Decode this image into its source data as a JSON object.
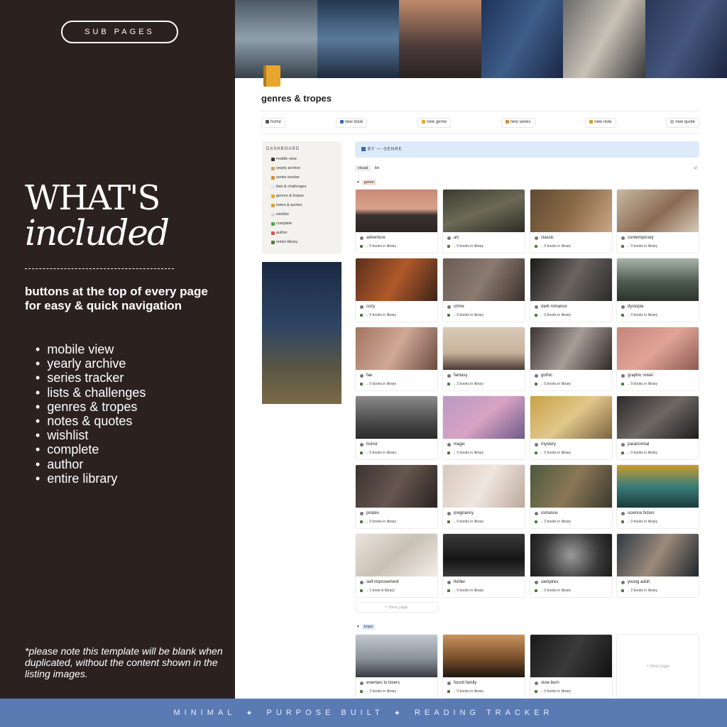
{
  "left": {
    "pill": "SUB PAGES",
    "heading_line1": "WHAT'S",
    "heading_line2": "included",
    "lead": "buttons at the top of every page for easy & quick navigation",
    "bullets": [
      "mobile view",
      "yearly archive",
      "series tracker",
      "lists & challenges",
      "genres & tropes",
      "notes & quotes",
      "wishlist",
      "complete",
      "author",
      "entire library"
    ],
    "note": "*please note this template will be blank when duplicated, without the content shown in the listing images."
  },
  "bottom_bar": {
    "part1": "MINIMAL",
    "sep": "✦",
    "part2": "PURPOSE BUILT",
    "part3": "READING TRACKER"
  },
  "page": {
    "title": "genres & tropes",
    "nav": [
      {
        "label": "home",
        "icon": "arrow-left-icon",
        "color": "#555555"
      },
      {
        "label": "new book",
        "icon": "book-icon",
        "color": "#3c68b0"
      },
      {
        "label": "new genre",
        "icon": "book-icon",
        "color": "#e7a72f"
      },
      {
        "label": "new series",
        "icon": "books-icon",
        "color": "#d98a2a"
      },
      {
        "label": "new note",
        "icon": "pencil-icon",
        "color": "#e0a020"
      },
      {
        "label": "new quote",
        "icon": "speech-bubble-icon",
        "color": "#bbbbbb"
      }
    ],
    "sidebar": {
      "title": "DASHBOARD",
      "items": [
        {
          "label": "mobile view",
          "color": "#333333"
        },
        {
          "label": "yearly archive",
          "color": "#c8a46a"
        },
        {
          "label": "series tracker",
          "color": "#d98a2a"
        },
        {
          "label": "lists & challenges",
          "color": "#e6e6e6"
        },
        {
          "label": "genres & tropes",
          "color": "#e7a72f"
        },
        {
          "label": "notes & quotes",
          "color": "#e0a020"
        },
        {
          "label": "wishlist",
          "color": "#d8d8d8"
        },
        {
          "label": "complete",
          "color": "#3fae3f"
        },
        {
          "label": "author",
          "color": "#d9534f"
        },
        {
          "label": "entire library",
          "color": "#4b7c3a"
        }
      ]
    },
    "callout": "BY — GENRE",
    "views": {
      "visual": "visual",
      "list": "list"
    },
    "group_genre": "genre",
    "group_trope": "trope",
    "new_page": "+ New page",
    "genres": [
      {
        "name": "adventure",
        "count": "→ 0 books in library",
        "bg": "linear-gradient(180deg,#c98a74,#d9a28c 45%,#3b3230 60%,#2b2523)"
      },
      {
        "name": "art",
        "count": "→ 0 books in library",
        "bg": "linear-gradient(160deg,#3b3b32,#6c6a55 50%,#2d2a24)"
      },
      {
        "name": "classic",
        "count": "→ 0 books in library",
        "bg": "linear-gradient(120deg,#5f4a32,#8a6a47 50%,#c9a688)"
      },
      {
        "name": "contemporary",
        "count": "→ 0 books in library",
        "bg": "linear-gradient(140deg,#c7b9a3,#8b6a52 55%,#d6cbbb)"
      },
      {
        "name": "cozy",
        "count": "→ 0 books in library",
        "bg": "linear-gradient(120deg,#5a2f1c,#b0592a 50%,#3d2419)"
      },
      {
        "name": "crime",
        "count": "→ 0 books in library",
        "bg": "linear-gradient(120deg,#6b5d55,#8a7a70 50%,#3b312c)"
      },
      {
        "name": "dark romance",
        "count": "→ 0 books in library",
        "bg": "linear-gradient(120deg,#1c1a1a,#6a6460 50%,#2c2a29)"
      },
      {
        "name": "dystopia",
        "count": "→ 0 books in library",
        "bg": "linear-gradient(180deg,#a7b3a9,#4e5b4f 55%,#2b332c)"
      },
      {
        "name": "fae",
        "count": "→ 0 books in library",
        "bg": "linear-gradient(120deg,#a27560,#d0a896 50%,#6a4c40)"
      },
      {
        "name": "fantasy",
        "count": "→ 2 books in library",
        "bg": "linear-gradient(180deg,#d8cbb7,#c8b29a 60%,#4a3a33)"
      },
      {
        "name": "gothic",
        "count": "→ 0 books in library",
        "bg": "linear-gradient(120deg,#3c3432,#a89d96 50%,#2e2826)"
      },
      {
        "name": "graphic novel",
        "count": "→ 0 books in library",
        "bg": "linear-gradient(140deg,#c5857a,#e0a496 50%,#8d5a52)"
      },
      {
        "name": "horror",
        "count": "→ 0 books in library",
        "bg": "linear-gradient(180deg,#8a8a8a,#4a4a4a 60%,#2a2a2a)"
      },
      {
        "name": "magic",
        "count": "→ 0 books in library",
        "bg": "linear-gradient(140deg,#b79ac6,#d9a3c3 50%,#6d5a8a)"
      },
      {
        "name": "mystery",
        "count": "→ 0 books in library",
        "bg": "linear-gradient(140deg,#c9a24a,#e1c78a 50%,#7a6340)"
      },
      {
        "name": "paranormal",
        "count": "→ 0 books in library",
        "bg": "linear-gradient(140deg,#2d2a2a,#6e6864 50%,#1f1d1d)"
      },
      {
        "name": "pirates",
        "count": "→ 0 books in library",
        "bg": "linear-gradient(120deg,#3b3331,#66564f 50%,#2a2322)"
      },
      {
        "name": "pregnancy",
        "count": "→ 0 books in library",
        "bg": "linear-gradient(120deg,#d8c8bc,#efe6df 50%,#bba99c)"
      },
      {
        "name": "romance",
        "count": "→ 2 books in library",
        "bg": "linear-gradient(120deg,#4b5a3e,#8b7756 50%,#3a3a2c)"
      },
      {
        "name": "science fiction",
        "count": "→ 0 books in library",
        "bg": "linear-gradient(180deg,#c99a30,#3a7d78 50%,#1a3a3c)"
      },
      {
        "name": "self improvement",
        "count": "→ 1 book in library",
        "bg": "linear-gradient(140deg,#e9e4dc,#c9c0b4 50%,#f2eee8)"
      },
      {
        "name": "thriller",
        "count": "→ 0 books in library",
        "bg": "linear-gradient(180deg,#3a3a3a,#151515 60%,#3c3c3c)"
      },
      {
        "name": "vampires",
        "count": "→ 0 books in library",
        "bg": "radial-gradient(circle at 50% 50%,#9a9a9a,#3a3a3a 60%,#1a1a1a)"
      },
      {
        "name": "young adult",
        "count": "→ 2 books in library",
        "bg": "linear-gradient(120deg,#2f3a44,#9b8a7a 50%,#1f262c)"
      }
    ],
    "tropes": [
      {
        "name": "enemies to lovers",
        "count": "→ 2 books in library",
        "bg": "linear-gradient(180deg,#c3c8cf,#8c939b 55%,#3a3d42)"
      },
      {
        "name": "found family",
        "count": "→ 0 books in library",
        "bg": "linear-gradient(180deg,#c9925a,#7a4f2c 55%,#1e1611)"
      },
      {
        "name": "slow burn",
        "count": "→ 0 books in library",
        "bg": "linear-gradient(120deg,#1a1a1a,#3a3a3a 50%,#111111)"
      }
    ],
    "banner": [
      {
        "bg": "linear-gradient(180deg,#4d5a66,#8fa0ad 50%,#37414a)"
      },
      {
        "bg": "linear-gradient(180deg,#243652,#5a7a9a 50%,#1d2a3e)"
      },
      {
        "bg": "linear-gradient(180deg,#c08a6a,#4a3a3a 60%,#2a2222)"
      },
      {
        "bg": "linear-gradient(120deg,#1e3358,#3e5d8a 50%,#1a2745)"
      },
      {
        "bg": "linear-gradient(120deg,#6a6a6a,#c8c2b6 50%,#3a3a3a)"
      },
      {
        "bg": "linear-gradient(120deg,#2a3758,#45567d 50%,#1c2540)"
      }
    ]
  }
}
